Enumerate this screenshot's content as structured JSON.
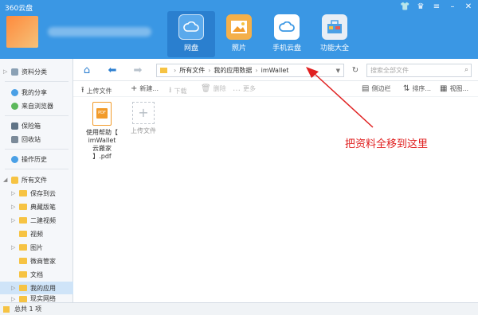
{
  "app": {
    "title": "360云盘"
  },
  "window_controls": [
    "shirt-icon",
    "trophy-icon",
    "menu-icon",
    "minimize-icon",
    "close-icon"
  ],
  "nav_tabs": [
    {
      "label": "网盘",
      "icon": "cloud-drive-icon",
      "active": true
    },
    {
      "label": "照片",
      "icon": "photo-icon",
      "active": false
    },
    {
      "label": "手机云盘",
      "icon": "phone-cloud-icon",
      "active": false
    },
    {
      "label": "功能大全",
      "icon": "toolbox-icon",
      "active": false
    }
  ],
  "sidebar": {
    "top": [
      {
        "label": "资料分类",
        "icon": "category-icon"
      },
      {
        "label": "我的分享",
        "icon": "share-icon"
      },
      {
        "label": "来自浏览器",
        "icon": "browser-icon"
      },
      {
        "label": "保险箱",
        "icon": "safe-icon"
      },
      {
        "label": "回收站",
        "icon": "recycle-bin-icon"
      },
      {
        "label": "操作历史",
        "icon": "history-icon"
      },
      {
        "label": "所有文件",
        "icon": "all-files-icon"
      }
    ],
    "folders": [
      "保存到云",
      "典藏版笔",
      "二建视频",
      "视频",
      "图片",
      "微商管家",
      "文档",
      "我的应用",
      "现实网络"
    ],
    "selected": "我的应用"
  },
  "address_bar": {
    "crumbs": [
      "所有文件",
      "我的应用数据",
      "imWallet"
    ],
    "search_placeholder": "搜索全部文件"
  },
  "toolbar": {
    "upload": "上传文件",
    "new": "新建",
    "download": "下载",
    "delete": "删除",
    "more": "更多",
    "sidebar_toggle": "侧边栏",
    "sort": "排序",
    "view": "视图"
  },
  "files": [
    {
      "name": "使用帮助【imWallet云搬家】.pdf",
      "type": "pdf",
      "badge": "PDF"
    },
    {
      "name": "上传文件",
      "type": "upload"
    }
  ],
  "file_label_lines": [
    "使用帮助【",
    "imWallet",
    "云搬家",
    "】.pdf"
  ],
  "annotation": "把资料全移到这里",
  "status_bar": {
    "text": "总共 1 项"
  }
}
